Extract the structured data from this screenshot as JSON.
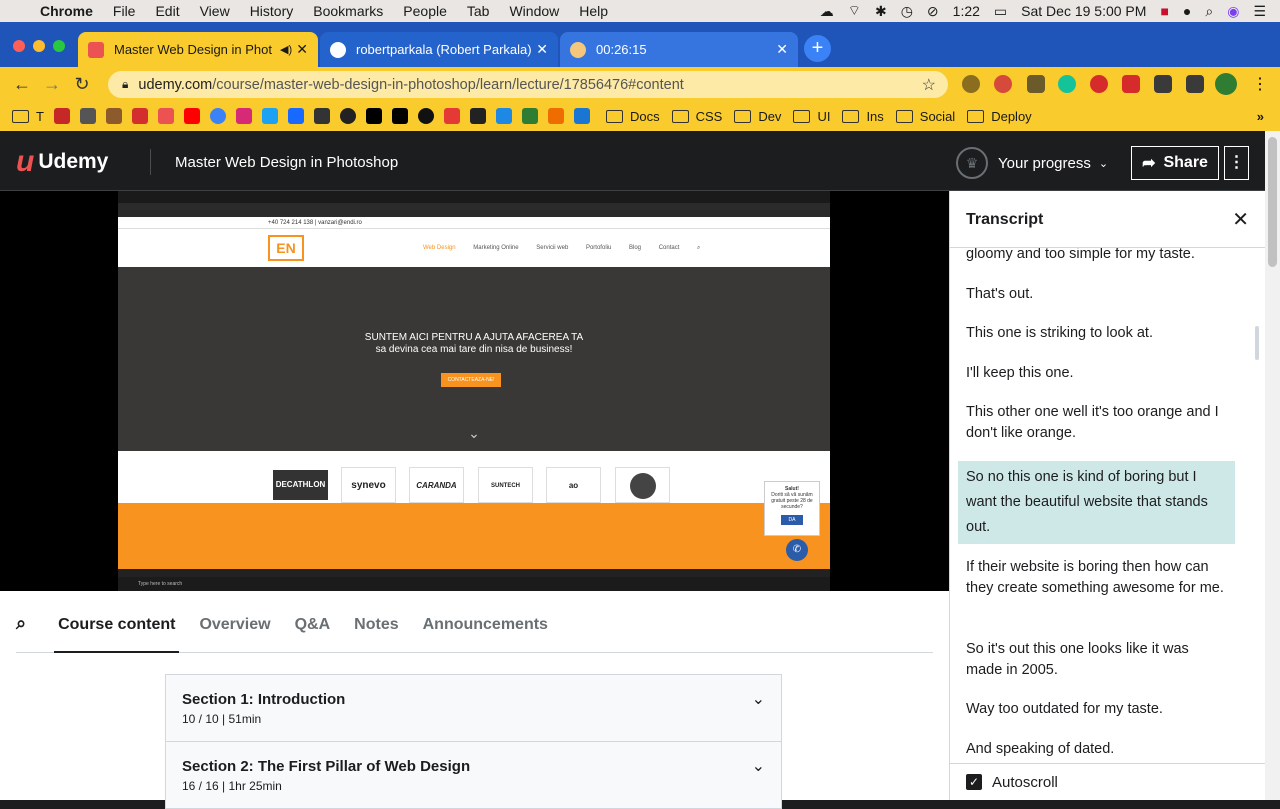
{
  "menubar": {
    "app": "Chrome",
    "items": [
      "File",
      "Edit",
      "View",
      "History",
      "Bookmarks",
      "People",
      "Tab",
      "Window",
      "Help"
    ],
    "battery_time": "1:22",
    "datetime": "Sat Dec 19  5:00 PM"
  },
  "tabs": [
    {
      "title": "Master Web Design in Phot",
      "active": true
    },
    {
      "title": "robertparkala (Robert Parkala)",
      "active": false
    },
    {
      "title": "00:26:15",
      "active": false
    }
  ],
  "address": {
    "domain": "udemy.com",
    "path": "/course/master-web-design-in-photoshop/learn/lecture/17856476#content"
  },
  "bookmarks": {
    "first_label": "T",
    "folders": [
      "Docs",
      "CSS",
      "Dev",
      "UI",
      "Ins",
      "Social",
      "Deploy"
    ]
  },
  "header": {
    "logo": "Udemy",
    "course_title": "Master Web Design in Photoshop",
    "progress_label": "Your progress",
    "share_label": "Share"
  },
  "video": {
    "site_top": "+40 724 214 138  |  vanzari@endi.ro",
    "logo_text": "EN",
    "menu": [
      "Web Design",
      "Marketing Online",
      "Servicii web",
      "Portofoliu",
      "Blog",
      "Contact"
    ],
    "hero_line1": "SUNTEM AICI PENTRU A AJUTA AFACEREA TA",
    "hero_line2": "sa devina cea mai tare din nisa de business!",
    "cta": "CONTACTEAZA-NE!",
    "clients": [
      "DECATHLON",
      "synevo",
      "CARANDA",
      "SUNTECH",
      "ao",
      "seal"
    ],
    "chat_title": "Salut!",
    "chat_text": "Doriti să vă sunăm gratuit peste 28 de secunde?",
    "chat_button": "DA",
    "taskbar_search": "Type here to search"
  },
  "content_tabs": [
    "Course content",
    "Overview",
    "Q&A",
    "Notes",
    "Announcements"
  ],
  "sections": [
    {
      "title": "Section 1: Introduction",
      "meta": "10 / 10 | 51min"
    },
    {
      "title": "Section 2: The First Pillar of Web Design",
      "meta": "16 / 16 | 1hr 25min"
    }
  ],
  "transcript": {
    "title": "Transcript",
    "cues": [
      "gloomy and too simple for my taste.",
      "That's out.",
      "This one is striking to look at.",
      "I'll keep this one.",
      "This other one well it's too orange and I don't like orange.",
      "So no this one is kind of boring but I want the beautiful website that stands out.",
      "If their website is boring then how can they create something awesome for me.",
      "So it's out this one looks like it was made in 2005.",
      "Way too outdated for my taste.",
      "And speaking of dated."
    ],
    "autoscroll_label": "Autoscroll"
  },
  "colors": {
    "tab_active": "#f9cb2c",
    "tabbar": "#1f55b8",
    "udemy_dark": "#1c1d1f",
    "highlight": "#cee8e8",
    "orange": "#f7931e"
  }
}
